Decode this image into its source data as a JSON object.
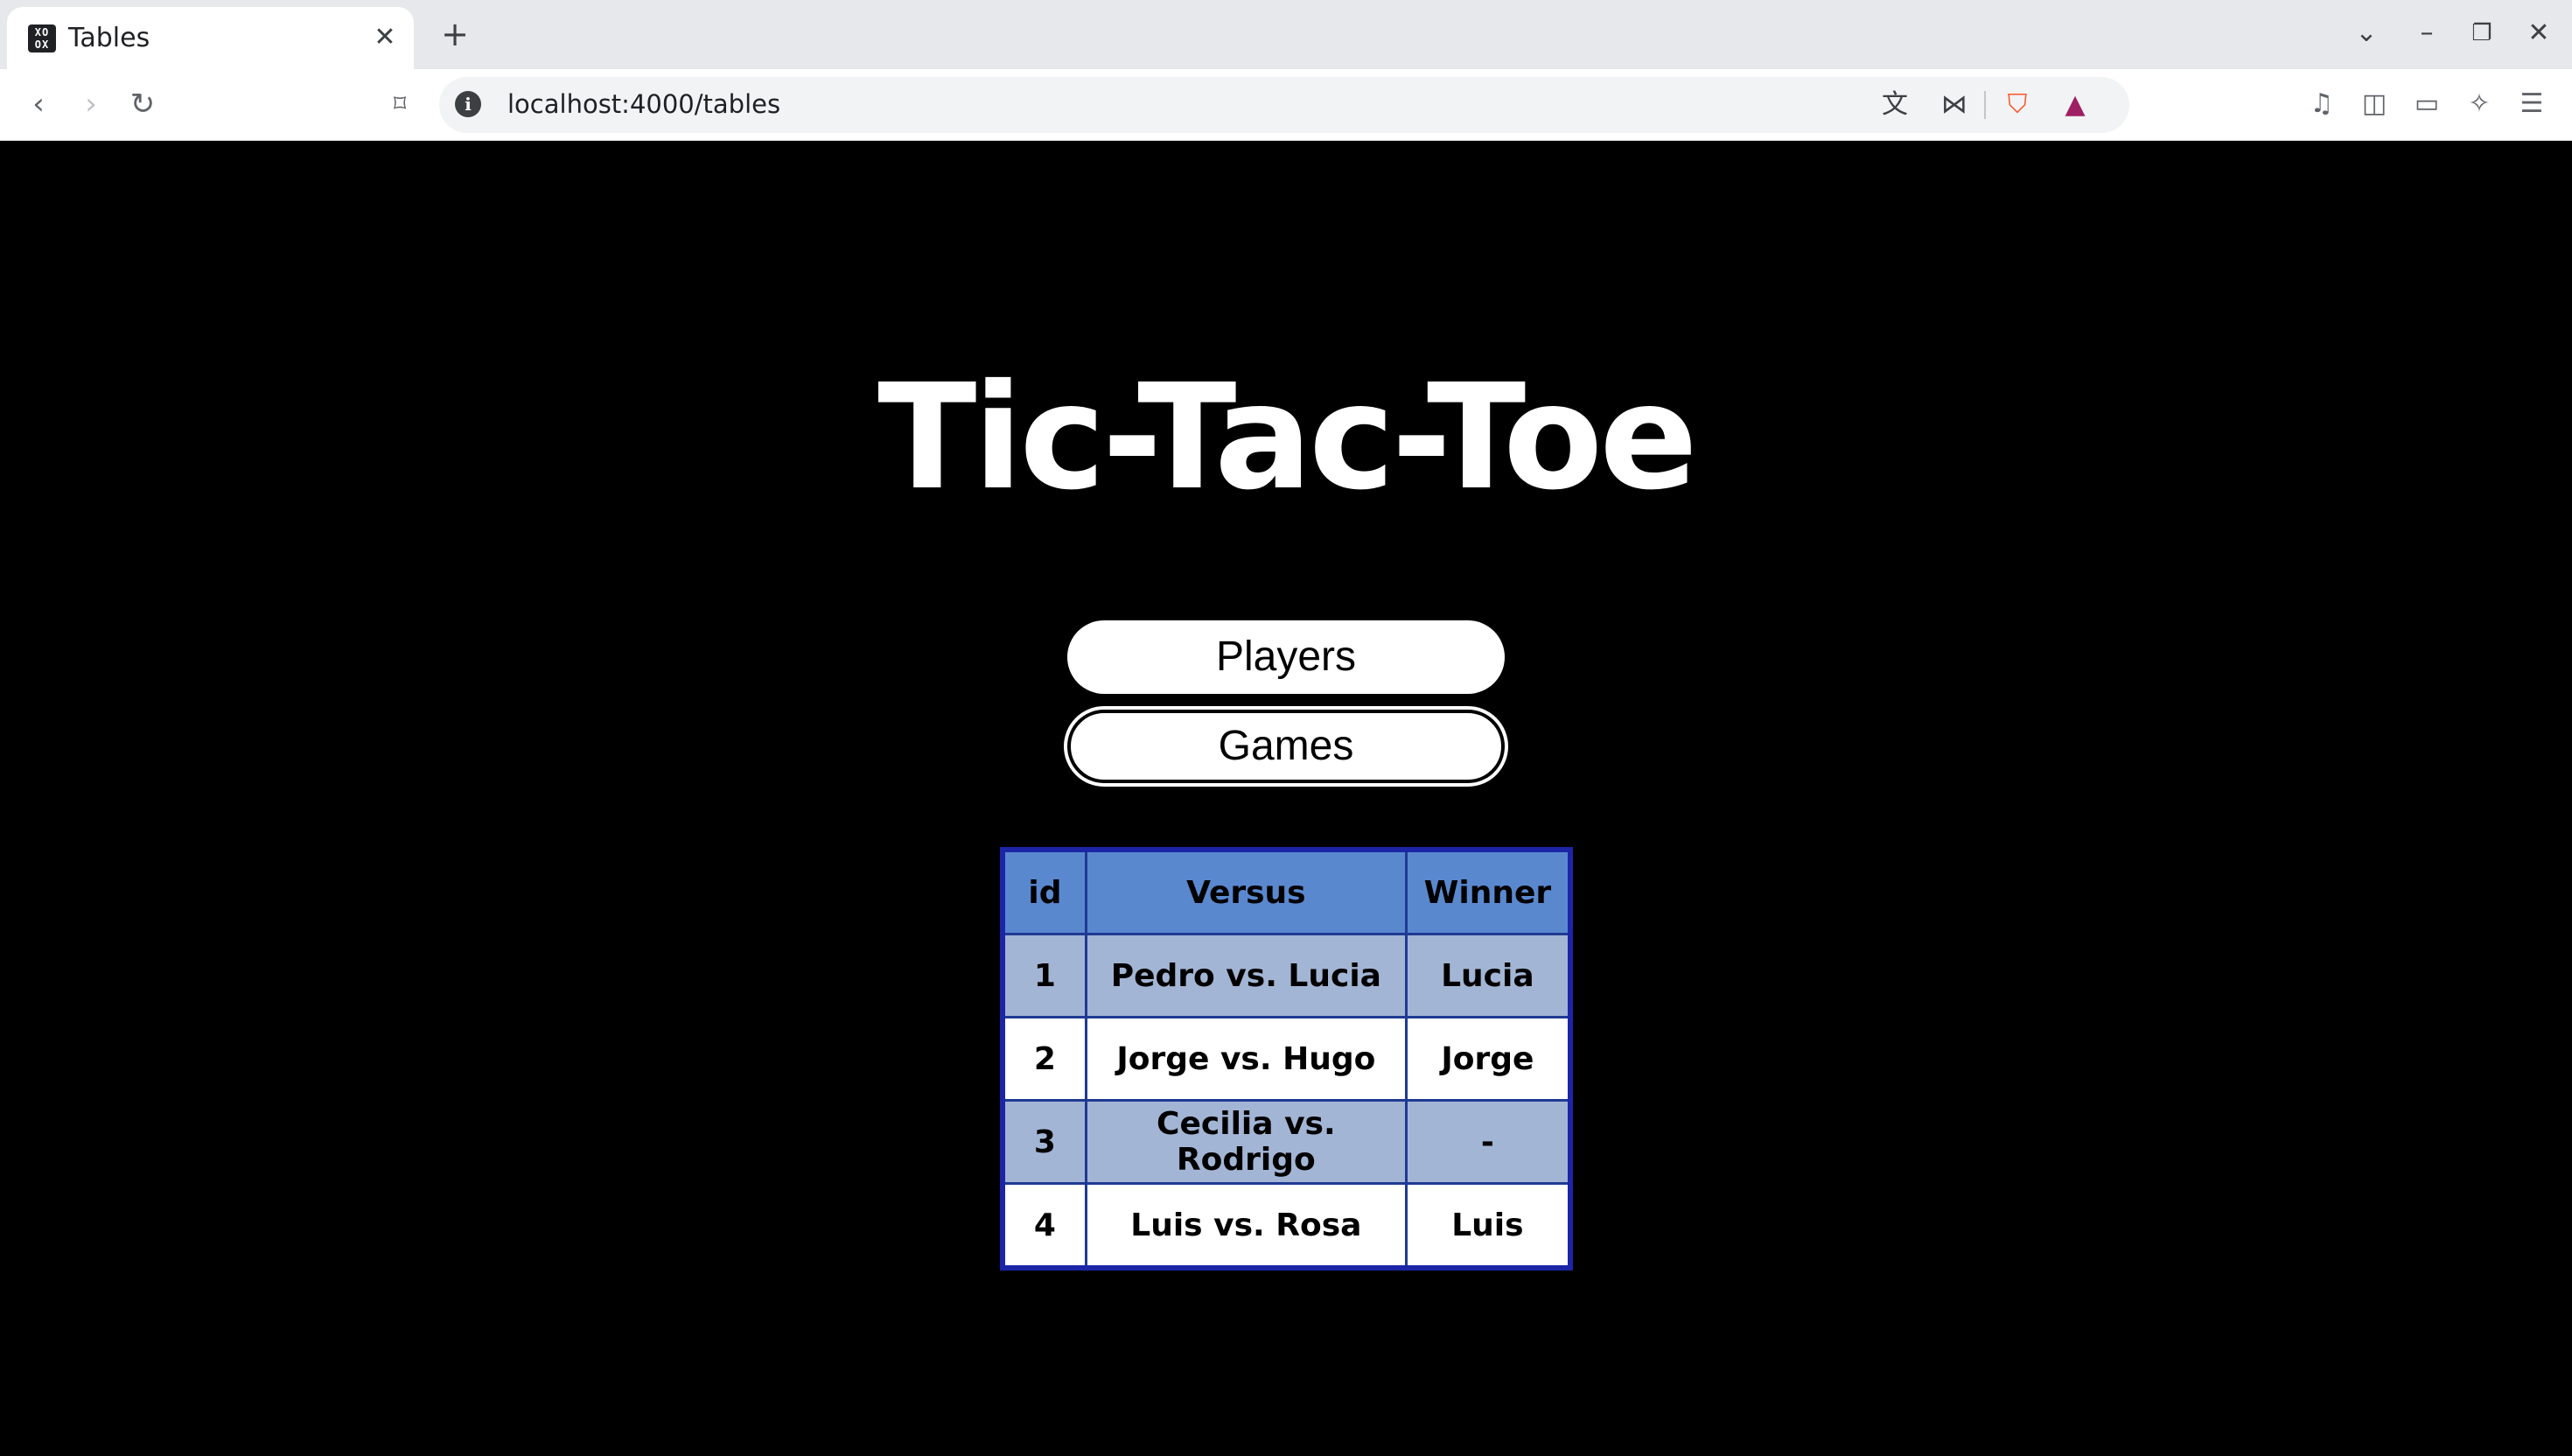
{
  "browser": {
    "tab": {
      "title": "Tables",
      "favicon": "xo-icon"
    },
    "new_tab_label": "+",
    "address": "localhost:4000/tables"
  },
  "page": {
    "title": "Tic-Tac-Toe",
    "nav": {
      "players_label": "Players",
      "games_label": "Games"
    },
    "table": {
      "headers": [
        "id",
        "Versus",
        "Winner"
      ],
      "rows": [
        {
          "id": "1",
          "versus": "Pedro vs. Lucia",
          "winner": "Lucia"
        },
        {
          "id": "2",
          "versus": "Jorge vs. Hugo",
          "winner": "Jorge"
        },
        {
          "id": "3",
          "versus": "Cecilia vs. Rodrigo",
          "winner": "-"
        },
        {
          "id": "4",
          "versus": "Luis vs. Rosa",
          "winner": "Luis"
        }
      ]
    }
  },
  "colors": {
    "table_border": "#1b25a6",
    "header_bg": "#5a88cf",
    "odd_row_bg": "#a3b5d4",
    "even_row_bg": "#ffffff",
    "page_bg": "#000000"
  }
}
